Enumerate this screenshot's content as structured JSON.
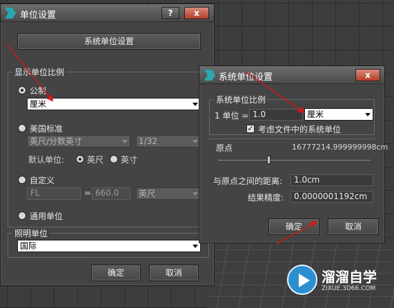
{
  "units_setup": {
    "title": "单位设置",
    "help_button": "?",
    "close_button": "x",
    "system_unit_setup_button": "系统单位设置",
    "display_unit_scale": {
      "title": "显示单位比例",
      "metric_label": "公制",
      "metric_value": "厘米",
      "us_standard_label": "美国标准",
      "us_standard_value": "英尺/分数英寸",
      "us_fraction_value": "1/32",
      "default_units_label": "默认单位:",
      "feet_label": "英尺",
      "inches_label": "英寸",
      "custom_label": "自定义",
      "custom_name_value": "FL",
      "equals": "=",
      "custom_amount_value": "660.0",
      "custom_unit_value": "英尺",
      "generic_label": "通用单位"
    },
    "lighting_units": {
      "title": "照明单位",
      "value": "国际"
    },
    "ok_button": "确定",
    "cancel_button": "取消"
  },
  "system_unit_setup": {
    "title": "系统单位设置",
    "close_button": "x",
    "scale_group_title": "系统单位比例",
    "one_unit_label": "1 单位 =",
    "one_unit_value": "1.0",
    "unit_select_value": "厘米",
    "respect_checkbox_label": "考虑文件中的系统单位",
    "respect_checkbox_mark": "✓",
    "origin_label": "原点",
    "origin_value": "16777214.999999998cm",
    "distance_label": "与原点之间的距离:",
    "distance_value": "1.0cm",
    "accuracy_label": "结果精度:",
    "accuracy_value": "0.0000001192cm",
    "ok_button": "确定",
    "cancel_button": "取消"
  },
  "watermark": {
    "name": "溜溜自学",
    "site": "ZIXUE.3D66.COM"
  },
  "colors": {
    "annotation_arrow": "#d01818",
    "close_button": "#b33d2a",
    "icon_teal": "#2aa7b0"
  }
}
